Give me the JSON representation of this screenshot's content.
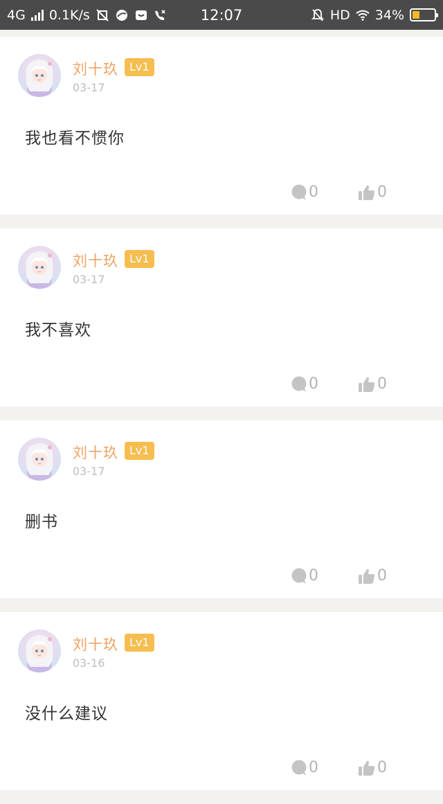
{
  "status_bar": {
    "network": "4G",
    "speed": "0.1K/s",
    "time": "12:07",
    "hd": "HD",
    "battery": "34%",
    "battery_level": 0.34,
    "battery_color": "#f6b924"
  },
  "comments": [
    {
      "user": "刘十玖",
      "level": "Lv1",
      "date": "03-17",
      "text": "我也看不惯你",
      "replies": "0",
      "likes": "0"
    },
    {
      "user": "刘十玖",
      "level": "Lv1",
      "date": "03-17",
      "text": "我不喜欢",
      "replies": "0",
      "likes": "0"
    },
    {
      "user": "刘十玖",
      "level": "Lv1",
      "date": "03-17",
      "text": "删书",
      "replies": "0",
      "likes": "0"
    },
    {
      "user": "刘十玖",
      "level": "Lv1",
      "date": "03-16",
      "text": "没什么建议",
      "replies": "0",
      "likes": "0"
    }
  ],
  "icons": {
    "reply": "comment-bubble-icon",
    "like": "thumbs-up-icon",
    "avatar": "anime-girl-avatar"
  },
  "colors": {
    "username": "#f0a464",
    "badge": "#f6bd4f",
    "date": "#bdbdbd",
    "action": "#b3b3b3",
    "separator": "#f3f2ee"
  }
}
